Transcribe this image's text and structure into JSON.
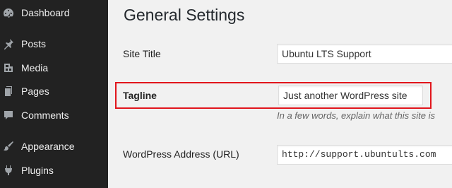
{
  "sidebar": {
    "items": [
      {
        "label": "Dashboard",
        "icon": "dashboard-icon"
      },
      {
        "label": "Posts",
        "icon": "pin-icon"
      },
      {
        "label": "Media",
        "icon": "media-icon"
      },
      {
        "label": "Pages",
        "icon": "pages-icon"
      },
      {
        "label": "Comments",
        "icon": "comment-icon"
      },
      {
        "label": "Appearance",
        "icon": "paintbrush-icon"
      },
      {
        "label": "Plugins",
        "icon": "plugin-icon"
      }
    ]
  },
  "main": {
    "title": "General Settings",
    "fields": {
      "site_title": {
        "label": "Site Title",
        "value": "Ubuntu LTS Support"
      },
      "tagline": {
        "label": "Tagline",
        "value": "Just another WordPress site",
        "description": "In a few words, explain what this site is"
      },
      "wordpress_address": {
        "label": "WordPress Address (URL)",
        "value": "http://support.ubuntults.com"
      }
    }
  },
  "colors": {
    "sidebar_bg": "#222222",
    "highlight": "#e1151c",
    "main_bg": "#f1f1f1"
  }
}
